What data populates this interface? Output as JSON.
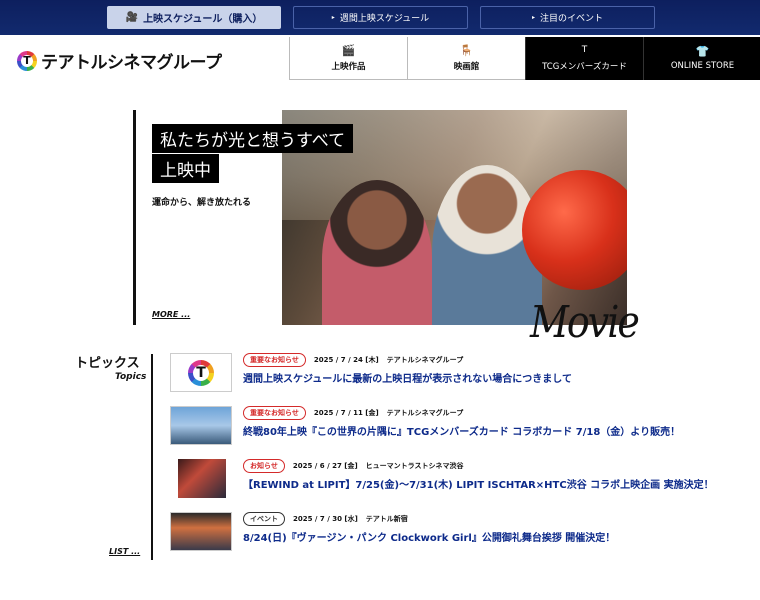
{
  "topbar": {
    "buttons": [
      {
        "label": "上映スケジュール（購入）",
        "icon": "film-camera-icon"
      },
      {
        "label": "週間上映スケジュール",
        "icon": "arrow-icon"
      },
      {
        "label": "注目のイベント",
        "icon": "arrow-icon"
      }
    ]
  },
  "header": {
    "logo_mark": "T",
    "logo_text": "テアトルシネマグループ",
    "nav": [
      {
        "label": "上映作品",
        "icon": "clapperboard-icon"
      },
      {
        "label": "映画館",
        "icon": "seats-icon"
      },
      {
        "label": "TCGメンバーズカード",
        "icon": "T"
      },
      {
        "label": "ONLINE STORE",
        "icon": "tshirt-icon"
      }
    ]
  },
  "hero": {
    "title_line1": "私たちが光と想うすべて",
    "title_line2": "上映中",
    "tagline": "運命から、解き放たれる",
    "more_label": "MORE ...",
    "movie_script": "Movie"
  },
  "topics": {
    "title": "トピックス",
    "subtitle": "Topics",
    "list_label": "LIST ...",
    "items": [
      {
        "badge": "重要なお知らせ",
        "date": "2025 / 7 / 24 [木]",
        "source": "テアトルシネマグループ",
        "headline": "週間上映スケジュールに最新の上映日程が表示されない場合につきまして"
      },
      {
        "badge": "重要なお知らせ",
        "date": "2025 / 7 / 11 [金]",
        "source": "テアトルシネマグループ",
        "headline": "終戦80年上映『この世界の片隅に』TCGメンバーズカード コラボカード 7/18（金）より販売！"
      },
      {
        "badge": "お知らせ",
        "date": "2025 / 6 / 27 [金]",
        "source": "ヒューマントラストシネマ渋谷",
        "headline": "【REWIND at LIPIT】7/25(金)～7/31(木) LIPIT ISCHTAR×HTC渋谷 コラボ上映企画 実施決定！"
      },
      {
        "badge": "イベント",
        "date": "2025 / 7 / 30 [水]",
        "source": "テアトル新宿",
        "headline": "8/24(日)『ヴァージン・パンク Clockwork Girl』公開御礼舞台挨拶 開催決定！"
      }
    ]
  }
}
